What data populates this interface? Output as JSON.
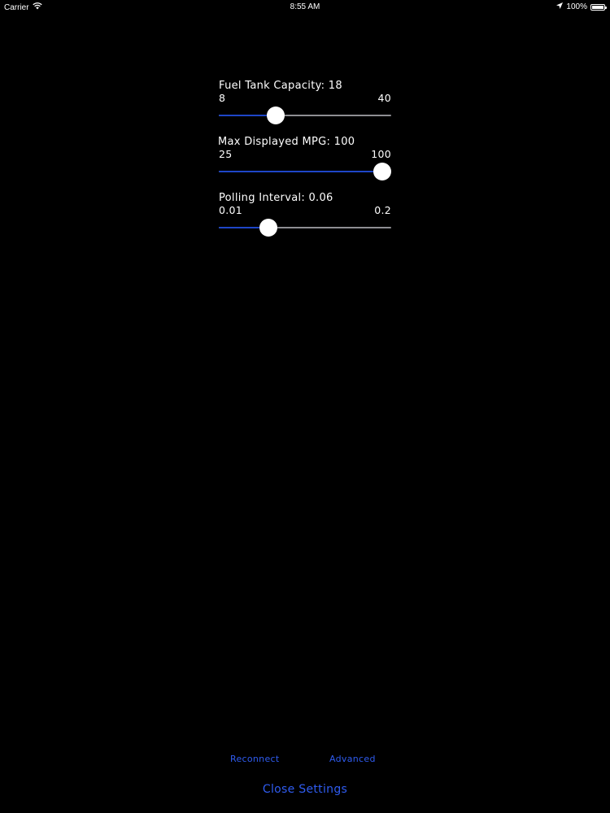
{
  "status_bar": {
    "carrier": "Carrier",
    "time": "8:55 AM",
    "battery": "100%",
    "battery_level": 1.0,
    "icons": [
      "wifi-icon",
      "location-arrow-icon",
      "battery-icon"
    ]
  },
  "colors": {
    "background": "#000000",
    "text": "#ffffff",
    "accent": "#2f5cf0",
    "slider_fill": "#1e46c8",
    "slider_track": "#8e8e93"
  },
  "settings": {
    "fuel_tank": {
      "title": "Fuel Tank Capacity: 18",
      "min_label": "8",
      "max_label": "40",
      "min": 8,
      "max": 40,
      "value": 18
    },
    "max_mpg": {
      "title": "Max Displayed MPG: 100",
      "min_label": "25",
      "max_label": "100",
      "min": 25,
      "max": 100,
      "value": 100
    },
    "polling": {
      "title": "Polling Interval: 0.06",
      "min_label": "0.01",
      "max_label": "0.2",
      "min": 0.01,
      "max": 0.2,
      "value": 0.06
    }
  },
  "actions": {
    "reconnect": "Reconnect",
    "advanced": "Advanced",
    "close_settings": "Close Settings"
  }
}
